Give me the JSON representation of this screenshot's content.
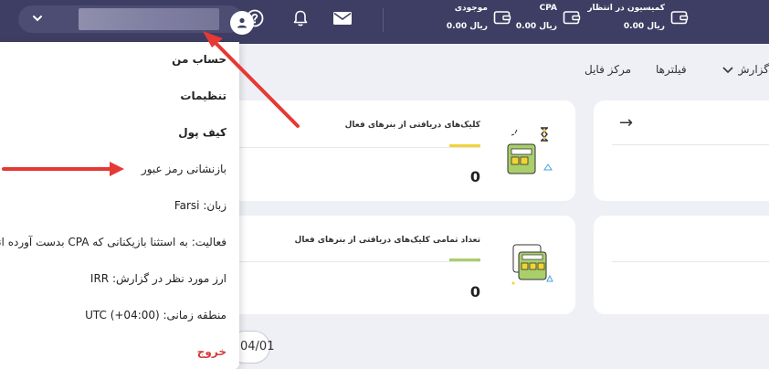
{
  "topbar": {
    "user_name_redacted": "",
    "wallets": [
      {
        "title": "کمیسیون در انتظار",
        "value": "ریال 0.00",
        "icon": "wallet-icon"
      },
      {
        "title": "CPA",
        "value": "ریال 0.00",
        "icon": "wallet-icon"
      },
      {
        "title": "موجودی",
        "value": "ریال 0.00",
        "icon": "wallet-icon"
      }
    ],
    "icons": [
      "user-icon",
      "help-icon",
      "bell-icon",
      "mail-icon",
      "chevron-down-icon"
    ]
  },
  "subnav": {
    "reports": "گزارش‌ها",
    "filters": "فیلترها",
    "file_center": "مرکز فایل"
  },
  "cards": {
    "top": {
      "title": "کلیک‌های دریافتی از بنرهای فعال",
      "value": "0"
    },
    "bottom": {
      "title": "تعداد تمامی کلیک‌های دریافتی از بنرهای فعال",
      "value": "0"
    },
    "right_top_arrow": "→"
  },
  "date_pill": "04/01",
  "menu": {
    "items": [
      "حساب من",
      "تنظیمات",
      "کیف پول",
      "بازنشانی رمز عبور",
      "زبان: Farsi",
      "فعالیت: به استثنا بازیکنانی که CPA بدست آورده اند",
      "ارز مورد نظر در گزارش: IRR",
      "منطقه زمانی: (UTC (+04:00",
      "خروج"
    ]
  },
  "colors": {
    "topbar": "#3e3d63",
    "pill": "#4d4c73",
    "background": "#eef0f5",
    "bar_yellow": "#f2d437",
    "bar_green": "#a9cf6a",
    "arrow_red": "#e53935",
    "logout_red": "#d63b3b"
  }
}
